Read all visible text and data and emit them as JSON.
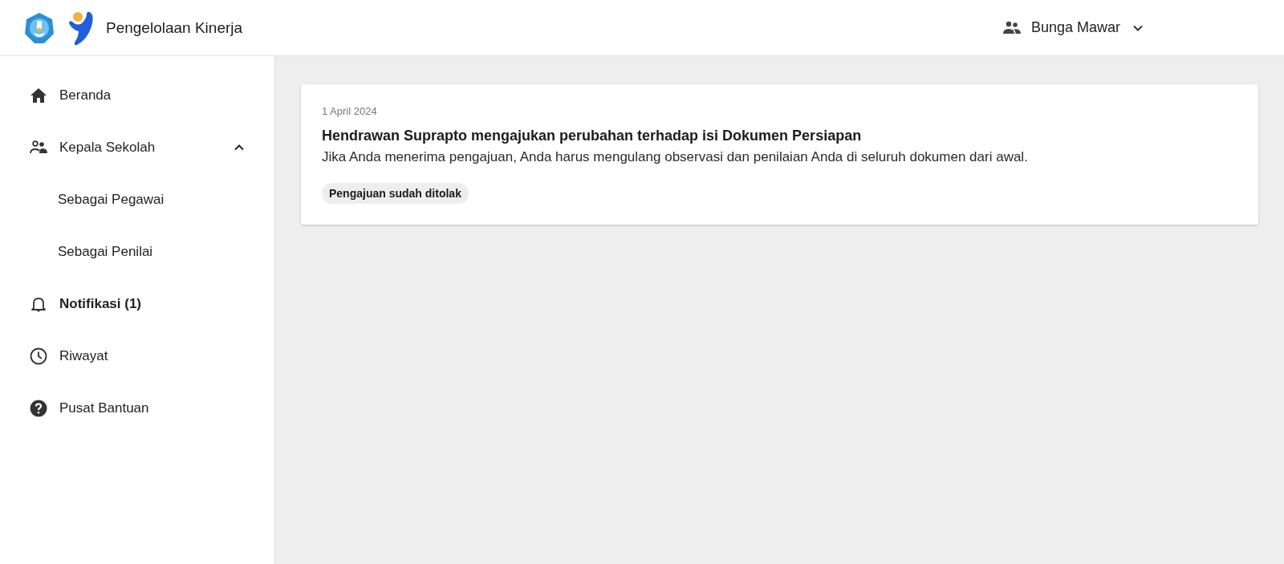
{
  "header": {
    "app_title": "Pengelolaan Kinerja",
    "user": {
      "name": "Bunga Mawar"
    }
  },
  "sidebar": {
    "items": [
      {
        "label": "Beranda",
        "selected": false
      },
      {
        "label": "Kepala Sekolah",
        "selected": false,
        "expanded": true,
        "children": [
          {
            "label": "Sebagai Pegawai",
            "selected": false
          },
          {
            "label": "Sebagai Penilai",
            "selected": false
          }
        ]
      },
      {
        "label": "Notifikasi (1)",
        "selected": true
      },
      {
        "label": "Riwayat",
        "selected": false
      },
      {
        "label": "Pusat Bantuan",
        "selected": false
      }
    ]
  },
  "notifications": [
    {
      "date": "1 April 2024",
      "title": "Hendrawan Suprapto mengajukan perubahan terhadap isi Dokumen Persiapan",
      "message": "Jika Anda menerima pengajuan, Anda harus mengulang observasi dan penilaian Anda di seluruh dokumen dari awal.",
      "status": "Pengajuan sudah ditolak"
    }
  ]
}
